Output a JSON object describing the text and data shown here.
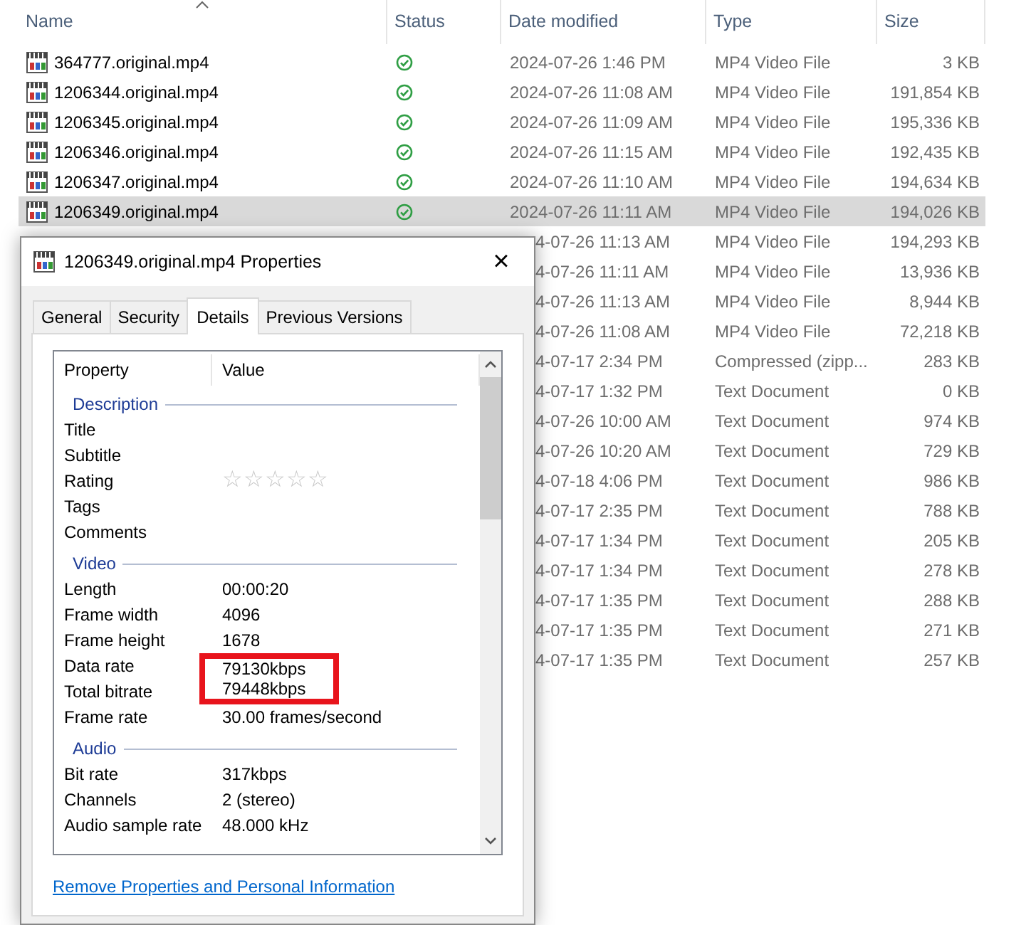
{
  "explorer": {
    "columns": [
      {
        "label": "Name",
        "sorted": true
      },
      {
        "label": "Status"
      },
      {
        "label": "Date modified"
      },
      {
        "label": "Type"
      },
      {
        "label": "Size"
      }
    ],
    "rows": [
      {
        "name": "364777.original.mp4",
        "synced": true,
        "date": "2024-07-26 1:46 PM",
        "type": "MP4 Video File",
        "size": "3 KB",
        "selected": false
      },
      {
        "name": "1206344.original.mp4",
        "synced": true,
        "date": "2024-07-26 11:08 AM",
        "type": "MP4 Video File",
        "size": "191,854 KB",
        "selected": false
      },
      {
        "name": "1206345.original.mp4",
        "synced": true,
        "date": "2024-07-26 11:09 AM",
        "type": "MP4 Video File",
        "size": "195,336 KB",
        "selected": false
      },
      {
        "name": "1206346.original.mp4",
        "synced": true,
        "date": "2024-07-26 11:15 AM",
        "type": "MP4 Video File",
        "size": "192,435 KB",
        "selected": false
      },
      {
        "name": "1206347.original.mp4",
        "synced": true,
        "date": "2024-07-26 11:10 AM",
        "type": "MP4 Video File",
        "size": "194,634 KB",
        "selected": false
      },
      {
        "name": "1206349.original.mp4",
        "synced": true,
        "date": "2024-07-26 11:11 AM",
        "type": "MP4 Video File",
        "size": "194,026 KB",
        "selected": true
      },
      {
        "date": "4-07-26 11:13 AM",
        "type": "MP4 Video File",
        "size": "194,293 KB",
        "selected": false
      },
      {
        "date": "4-07-26 11:11 AM",
        "type": "MP4 Video File",
        "size": "13,936 KB",
        "selected": false
      },
      {
        "date": "4-07-26 11:13 AM",
        "type": "MP4 Video File",
        "size": "8,944 KB",
        "selected": false
      },
      {
        "date": "4-07-26 11:08 AM",
        "type": "MP4 Video File",
        "size": "72,218 KB",
        "selected": false
      },
      {
        "date": "4-07-17 2:34 PM",
        "type": "Compressed (zipp...",
        "size": "283 KB",
        "selected": false
      },
      {
        "date": "4-07-17 1:32 PM",
        "type": "Text Document",
        "size": "0 KB",
        "selected": false
      },
      {
        "date": "4-07-26 10:00 AM",
        "type": "Text Document",
        "size": "974 KB",
        "selected": false
      },
      {
        "date": "4-07-26 10:20 AM",
        "type": "Text Document",
        "size": "729 KB",
        "selected": false
      },
      {
        "date": "4-07-18 4:06 PM",
        "type": "Text Document",
        "size": "986 KB",
        "selected": false
      },
      {
        "date": "4-07-17 2:35 PM",
        "type": "Text Document",
        "size": "788 KB",
        "selected": false
      },
      {
        "date": "4-07-17 1:34 PM",
        "type": "Text Document",
        "size": "205 KB",
        "selected": false
      },
      {
        "date": "4-07-17 1:34 PM",
        "type": "Text Document",
        "size": "278 KB",
        "selected": false
      },
      {
        "date": "4-07-17 1:35 PM",
        "type": "Text Document",
        "size": "288 KB",
        "selected": false
      },
      {
        "date": "4-07-17 1:35 PM",
        "type": "Text Document",
        "size": "271 KB",
        "selected": false
      },
      {
        "date": "4-07-17 1:35 PM",
        "type": "Text Document",
        "size": "257 KB",
        "selected": false
      }
    ]
  },
  "dialog": {
    "title": "1206349.original.mp4 Properties",
    "close": "×",
    "tabs": [
      {
        "label": "General",
        "selected": false
      },
      {
        "label": "Security",
        "selected": false
      },
      {
        "label": "Details",
        "selected": true
      },
      {
        "label": "Previous Versions",
        "selected": false
      }
    ],
    "columns": [
      "Property",
      "Value"
    ],
    "groups": [
      {
        "heading": "Description",
        "items": [
          {
            "property": "Title"
          },
          {
            "property": "Subtitle"
          },
          {
            "property": "Rating",
            "stars": 0
          },
          {
            "property": "Tags"
          },
          {
            "property": "Comments"
          }
        ]
      },
      {
        "heading": "Video",
        "items": [
          {
            "property": "Length",
            "value": "00:00:20",
            "highlighted": false
          },
          {
            "property": "Frame width",
            "value": "4096",
            "highlighted": false
          },
          {
            "property": "Frame height",
            "value": "1678",
            "highlighted": false
          },
          {
            "property": "Data rate",
            "value": "79130kbps",
            "highlighted": true
          },
          {
            "property": "Total bitrate",
            "value": "79448kbps",
            "highlighted": true
          },
          {
            "property": "Frame rate",
            "value": "30.00 frames/second",
            "highlighted": false
          }
        ]
      },
      {
        "heading": "Audio",
        "items": [
          {
            "property": "Bit rate",
            "value": "317kbps",
            "highlighted": false
          },
          {
            "property": "Channels",
            "value": "2 (stereo)",
            "highlighted": false
          },
          {
            "property": "Audio sample rate",
            "value": "48.000 kHz",
            "highlighted": false
          }
        ]
      }
    ],
    "link": "Remove Properties and Personal Information"
  }
}
